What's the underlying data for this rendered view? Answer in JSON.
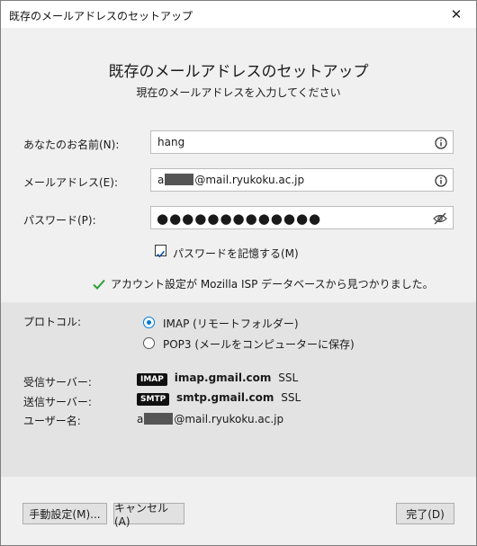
{
  "window": {
    "title": "既存のメールアドレスのセットアップ"
  },
  "header": {
    "title": "既存のメールアドレスのセットアップ",
    "subtitle": "現在のメールアドレスを入力してください"
  },
  "form": {
    "name_label": "あなたのお名前(N):",
    "name_value": "hang",
    "email_label": "メールアドレス(E):",
    "email_prefix": "a",
    "email_suffix": "@mail.ryukoku.ac.jp",
    "password_label": "パスワード(P):",
    "password_mask": "●●●●●●●●●●●●●",
    "remember_label": "パスワードを記憶する(M)",
    "remember_checked": true
  },
  "status": {
    "found_message": "アカウント設定が Mozilla ISP データベースから見つかりました。"
  },
  "config": {
    "protocol_label": "プロトコル:",
    "imap_option": "IMAP (リモートフォルダー)",
    "pop3_option": "POP3 (メールをコンピューターに保存)",
    "incoming_label": "受信サーバー:",
    "incoming_badge": "IMAP",
    "incoming_host": "imap.gmail.com",
    "incoming_security": "SSL",
    "outgoing_label": "送信サーバー:",
    "outgoing_badge": "SMTP",
    "outgoing_host": "smtp.gmail.com",
    "outgoing_security": "SSL",
    "username_label": "ユーザー名:",
    "username_prefix": "a",
    "username_suffix": "@mail.ryukoku.ac.jp"
  },
  "buttons": {
    "manual": "手動設定(M)...",
    "cancel": "キャンセル(A)",
    "done": "完了(D)"
  },
  "colors": {
    "accent": "#0078d7",
    "success": "#2e9d3a"
  }
}
